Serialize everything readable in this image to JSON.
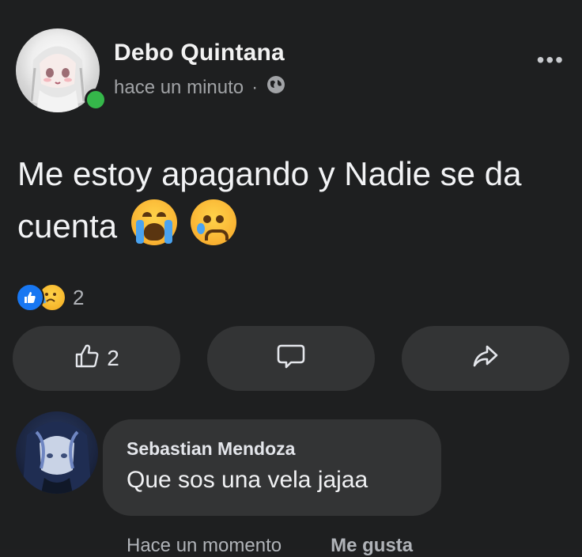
{
  "post": {
    "author": "Debo Quintana",
    "time": "hace un minuto",
    "separator": "·",
    "more_label": "•••",
    "text": "Me estoy apagando y Nadie se da cuenta",
    "emojis": [
      "loudly-crying-face",
      "sad-but-relieved-face"
    ],
    "reactions": {
      "types": [
        "like",
        "sad"
      ],
      "count": "2"
    },
    "actions": {
      "like_count": "2"
    }
  },
  "comment": {
    "author": "Sebastian Mendoza",
    "text": "Que sos una vela jajaa",
    "time": "Hace un momento",
    "like_label": "Me gusta"
  },
  "colors": {
    "background": "#1e1f20",
    "button_bg": "#333435",
    "online": "#35b74a",
    "like_blue": "#1877f2",
    "muted_text": "#a1a3a6"
  },
  "icons": {
    "globe": "globe-icon",
    "like": "thumbs-up-icon",
    "comment": "comment-bubble-icon",
    "share": "share-arrow-icon"
  }
}
